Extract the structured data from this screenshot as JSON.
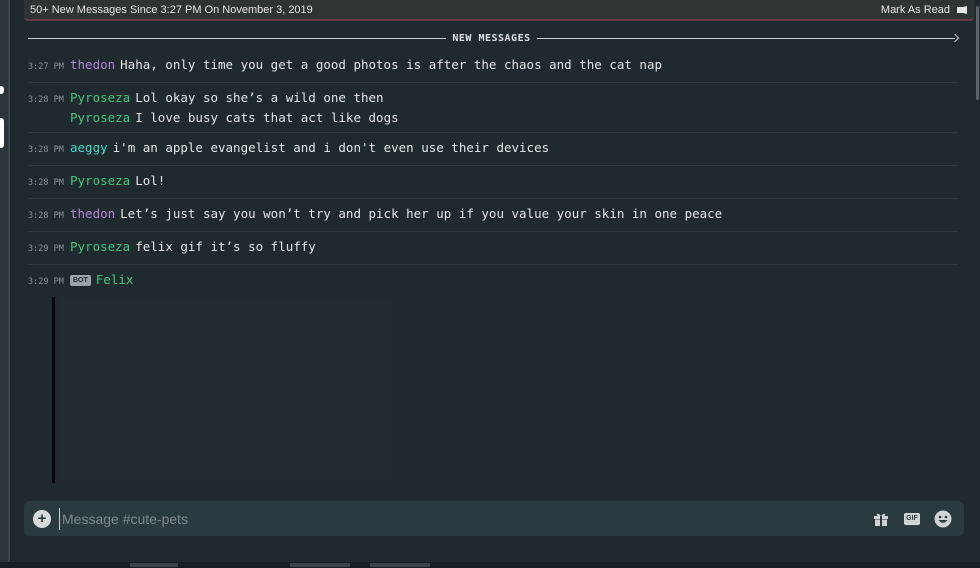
{
  "banner": {
    "text": "50+ New Messages Since 3:27 PM On November 3, 2019",
    "mark_read": "Mark As Read"
  },
  "divider": {
    "label": "NEW MESSAGES"
  },
  "messages": [
    {
      "time": "3:27 PM",
      "user": "thedon",
      "color": "#b583d6",
      "lines": [
        "Haha, only time you get a good photos is after the chaos and the cat nap"
      ]
    },
    {
      "time": "3:28 PM",
      "user": "Pyroseza",
      "color": "#43c57e",
      "lines": [
        "Lol okay so she’s a wild one then",
        "I love busy cats that act like dogs"
      ]
    },
    {
      "time": "3:28 PM",
      "user": "aeggy",
      "color": "#3fd9c8",
      "lines": [
        "i'm an apple evangelist and i don't even use their devices"
      ]
    },
    {
      "time": "3:28 PM",
      "user": "Pyroseza",
      "color": "#43c57e",
      "lines": [
        "Lol!"
      ]
    },
    {
      "time": "3:28 PM",
      "user": "thedon",
      "color": "#b583d6",
      "lines": [
        "Let’s just say you won’t try and pick her up if you value your skin in one peace"
      ]
    },
    {
      "time": "3:29 PM",
      "user": "Pyroseza",
      "color": "#43c57e",
      "lines": [
        "felix gif it’s so fluffy"
      ]
    }
  ],
  "bot_message": {
    "time": "3:29 PM",
    "tag": "BOT",
    "user": "Felix",
    "color": "#43c57e"
  },
  "composer": {
    "placeholder": "Message #cute-pets",
    "value": "",
    "gif_label": "GIF",
    "icons": [
      "plus-circle-icon",
      "gift-icon",
      "gif-icon",
      "emoji-icon"
    ]
  }
}
